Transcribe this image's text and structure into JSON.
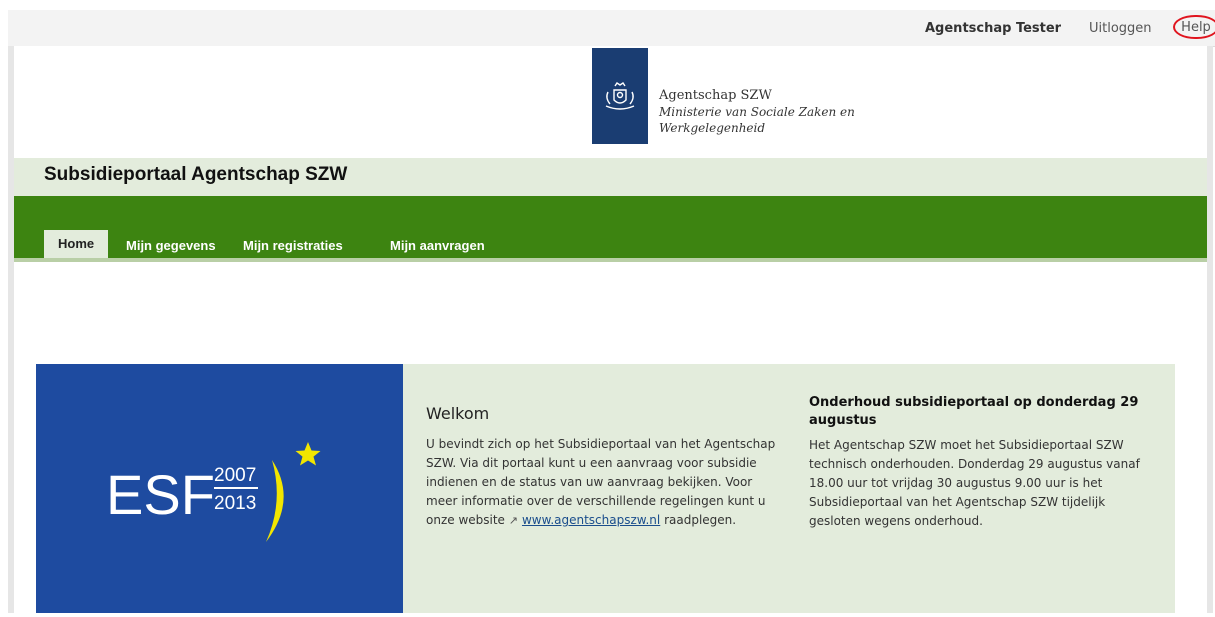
{
  "topbar": {
    "user_name": "Agentschap Tester",
    "logout_label": "Uitloggen",
    "help_label": "Help"
  },
  "branding": {
    "org_name": "Agentschap SZW",
    "ministry_line1": "Ministerie van Sociale Zaken en",
    "ministry_line2": "Werkgelegenheid",
    "portal_title": "Subsidieportaal Agentschap SZW"
  },
  "nav": {
    "tabs": [
      {
        "label": "Home"
      },
      {
        "label": "Mijn gegevens"
      },
      {
        "label": "Mijn registraties"
      },
      {
        "label": "Mijn aanvragen"
      }
    ]
  },
  "esf_logo": {
    "text": "ESF",
    "year_top": "2007",
    "year_bottom": "2013"
  },
  "welcome": {
    "heading": "Welkom",
    "body": "U bevindt zich op het Subsidieportaal van het Agentschap SZW. Via dit portaal kunt u een aanvraag voor subsidie indienen en de status van uw aanvraag bekijken. Voor meer informatie over de verschillende regelingen kunt u onze website",
    "link_text": "www.agentschapszw.nl",
    "trailing": "raadplegen."
  },
  "notice": {
    "heading": "Onderhoud subsidieportaal op donderdag 29 augustus",
    "body": "Het Agentschap SZW moet het Subsidieportaal SZW technisch onderhouden. Donderdag 29 augustus vanaf 18.00 uur tot vrijdag 30 augustus 9.00 uur is het Subsidieportaal van het Agentschap SZW tijdelijk gesloten wegens onderhoud."
  },
  "colors": {
    "nav_green": "#3d8411",
    "light_green": "#e3ecdc",
    "logo_blue": "#1a3d72",
    "esf_blue": "#1e4ba0",
    "star_yellow": "#f2e600",
    "help_circle_red": "#e0141e"
  },
  "icons": {
    "external_link": "external-link-icon",
    "coat_of_arms": "coat-of-arms-icon",
    "star": "star-icon"
  }
}
